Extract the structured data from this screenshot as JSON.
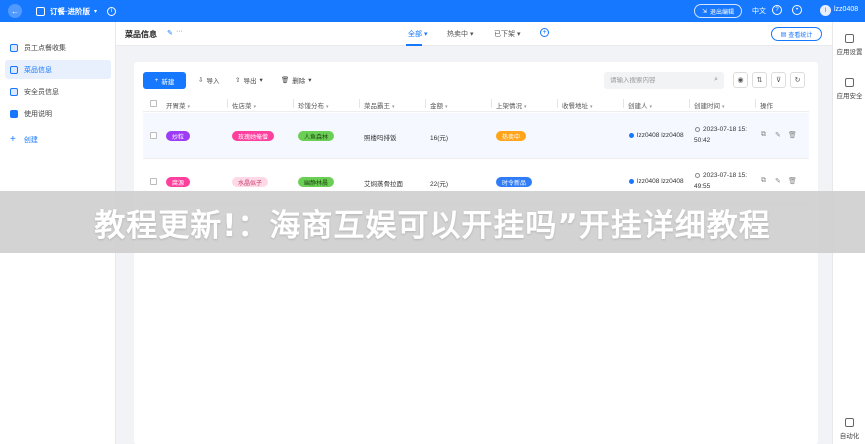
{
  "topbar": {
    "app_name": "订餐·进阶版",
    "exit_edit": "退出编辑",
    "lang": "中文",
    "user": "lzz0408",
    "avatar_letter": "l"
  },
  "sidebar": {
    "items": [
      {
        "label": "员工点餐收集"
      },
      {
        "label": "菜品信息"
      },
      {
        "label": "安全员信息"
      },
      {
        "label": "使用说明"
      }
    ],
    "create_label": "创建"
  },
  "subbar": {
    "title": "菜品信息",
    "more": "···",
    "tabs": [
      {
        "label": "全部"
      },
      {
        "label": "热卖中"
      },
      {
        "label": "已下架"
      }
    ],
    "add_tab": "+",
    "stats_label": "查看统计"
  },
  "right_panel": {
    "items": [
      {
        "label": "应用设置"
      },
      {
        "label": "应用安全"
      },
      {
        "label": "自动化"
      }
    ]
  },
  "toolbar": {
    "new": "新建",
    "import": "导入",
    "export": "导出",
    "delete": "删除",
    "search_placeholder": "请输入搜索内容"
  },
  "table": {
    "headers": [
      "开胃菜",
      "佐店菜",
      "珍馐分布",
      "菜品霸王",
      "金额",
      "上架情况",
      "收餐地址",
      "创建人",
      "创建时间",
      "操作"
    ],
    "rows": [
      {
        "appetizer": "炒粒",
        "side": "玫瑰她俺僧",
        "distribution": "人鱼森林",
        "dish": "照楼吗排饭",
        "amount": "16(元)",
        "status": "热卖中",
        "creator": "lzz0408 lzz0408",
        "time_1": "2023-07-18 15:",
        "time_2": "50:42"
      },
      {
        "appetizer": "腐源",
        "side": "水晶似子",
        "distribution": "幽静林晨",
        "dish": "艾焖蒸骨拉面",
        "amount": "22(元)",
        "status": "时令新品",
        "creator": "lzz0408 lzz0408",
        "time_1": "2023-07-18 15:",
        "time_2": "49:55"
      }
    ]
  },
  "overlay_text": "教程更新!：海商互娱可以开挂吗”开挂详细教程",
  "colors": {
    "primary": "#1677ff",
    "tag_purple": "#9d3cf5",
    "tag_pink": "#ff3f9d",
    "tag_green": "#6ccf55",
    "tag_orange": "#ffa41b",
    "tag_blue": "#2f7cf6",
    "tag_pinklight": "#ffd9e6"
  }
}
